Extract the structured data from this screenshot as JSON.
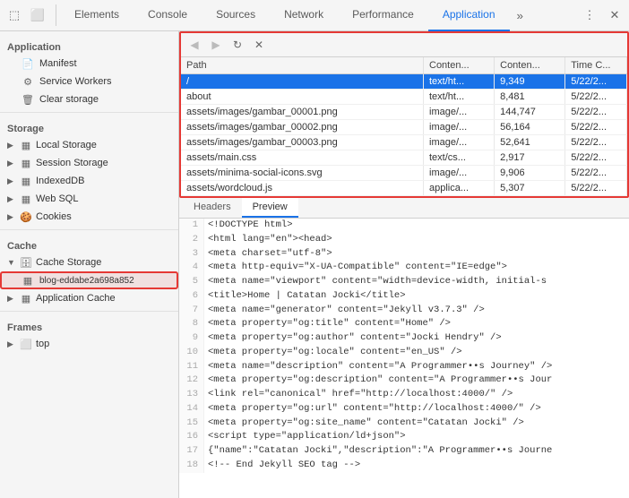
{
  "toolbar": {
    "icons": [
      {
        "name": "inspect-icon",
        "glyph": "⬚"
      },
      {
        "name": "device-icon",
        "glyph": "⬜"
      }
    ],
    "tabs": [
      {
        "id": "elements",
        "label": "Elements"
      },
      {
        "id": "console",
        "label": "Console"
      },
      {
        "id": "sources",
        "label": "Sources"
      },
      {
        "id": "network",
        "label": "Network"
      },
      {
        "id": "performance",
        "label": "Performance"
      },
      {
        "id": "application",
        "label": "Application"
      }
    ],
    "active_tab": "application",
    "overflow_label": "»",
    "more_label": "⋮",
    "close_label": "✕"
  },
  "sidebar": {
    "app_label": "Application",
    "items": [
      {
        "id": "manifest",
        "label": "Manifest",
        "icon": "📄",
        "indent": 1
      },
      {
        "id": "service-workers",
        "label": "Service Workers",
        "icon": "⚙",
        "indent": 1
      },
      {
        "id": "clear-storage",
        "label": "Clear storage",
        "icon": "🗑",
        "indent": 1
      }
    ],
    "storage_label": "Storage",
    "storage_items": [
      {
        "id": "local-storage",
        "label": "Local Storage",
        "icon": "▦",
        "has_arrow": true
      },
      {
        "id": "session-storage",
        "label": "Session Storage",
        "icon": "▦",
        "has_arrow": true
      },
      {
        "id": "indexeddb",
        "label": "IndexedDB",
        "icon": "▦",
        "has_arrow": true
      },
      {
        "id": "web-sql",
        "label": "Web SQL",
        "icon": "▦",
        "has_arrow": true
      },
      {
        "id": "cookies",
        "label": "Cookies",
        "icon": "🍪",
        "has_arrow": true
      }
    ],
    "cache_label": "Cache",
    "cache_items": [
      {
        "id": "cache-storage",
        "label": "Cache Storage",
        "icon": "🗄",
        "has_arrow": true
      },
      {
        "id": "blog-cache",
        "label": "blog-eddabe2a698a852",
        "icon": "▦",
        "highlighted": true
      },
      {
        "id": "app-cache",
        "label": "Application Cache",
        "icon": "▦",
        "has_arrow": true
      }
    ],
    "frames_label": "Frames",
    "frame_items": [
      {
        "id": "frame-top",
        "label": "top",
        "icon": "⬜",
        "has_arrow": true
      }
    ]
  },
  "table": {
    "nav_buttons": [
      {
        "name": "back-btn",
        "label": "◀",
        "disabled": true
      },
      {
        "name": "forward-btn",
        "label": "▶",
        "disabled": true
      },
      {
        "name": "refresh-btn",
        "label": "↻",
        "disabled": false
      },
      {
        "name": "clear-btn",
        "label": "✕",
        "disabled": false
      }
    ],
    "columns": [
      {
        "id": "path",
        "label": "Path"
      },
      {
        "id": "content-type",
        "label": "Conten..."
      },
      {
        "id": "content-enc",
        "label": "Conten..."
      },
      {
        "id": "time-created",
        "label": "Time C..."
      }
    ],
    "rows": [
      {
        "path": "/",
        "content_type": "text/ht...",
        "content_enc": "9,349",
        "time": "5/22/2...",
        "selected": true
      },
      {
        "path": "about",
        "content_type": "text/ht...",
        "content_enc": "8,481",
        "time": "5/22/2...",
        "selected": false
      },
      {
        "path": "assets/images/gambar_00001.png",
        "content_type": "image/...",
        "content_enc": "144,747",
        "time": "5/22/2...",
        "selected": false
      },
      {
        "path": "assets/images/gambar_00002.png",
        "content_type": "image/...",
        "content_enc": "56,164",
        "time": "5/22/2...",
        "selected": false
      },
      {
        "path": "assets/images/gambar_00003.png",
        "content_type": "image/...",
        "content_enc": "52,641",
        "time": "5/22/2...",
        "selected": false
      },
      {
        "path": "assets/main.css",
        "content_type": "text/cs...",
        "content_enc": "2,917",
        "time": "5/22/2...",
        "selected": false
      },
      {
        "path": "assets/minima-social-icons.svg",
        "content_type": "image/...",
        "content_enc": "9,906",
        "time": "5/22/2...",
        "selected": false
      },
      {
        "path": "assets/wordcloud.js",
        "content_type": "applica...",
        "content_enc": "5,307",
        "time": "5/22/2...",
        "selected": false
      }
    ]
  },
  "preview": {
    "tabs": [
      {
        "id": "headers",
        "label": "Headers"
      },
      {
        "id": "preview",
        "label": "Preview"
      }
    ],
    "active_tab": "preview",
    "code_lines": [
      {
        "num": 1,
        "content": "<!DOCTYPE html>"
      },
      {
        "num": 2,
        "content": "<html lang=\"en\"><head>"
      },
      {
        "num": 3,
        "content": "  <meta charset=\"utf-8\">"
      },
      {
        "num": 4,
        "content": "  <meta http-equiv=\"X-UA-Compatible\" content=\"IE=edge\">"
      },
      {
        "num": 5,
        "content": "  <meta name=\"viewport\" content=\"width=device-width, initial-s"
      },
      {
        "num": 6,
        "content": "<title>Home | Catatan Jocki</title>"
      },
      {
        "num": 7,
        "content": "  <meta name=\"generator\" content=\"Jekyll v3.7.3\" />"
      },
      {
        "num": 8,
        "content": "  <meta property=\"og:title\" content=\"Home\" />"
      },
      {
        "num": 9,
        "content": "  <meta property=\"og:author\" content=\"Jocki Hendry\" />"
      },
      {
        "num": 10,
        "content": "  <meta property=\"og:locale\" content=\"en_US\" />"
      },
      {
        "num": 11,
        "content": "  <meta name=\"description\" content=\"A Programmer••s Journey\" />"
      },
      {
        "num": 12,
        "content": "  <meta property=\"og:description\" content=\"A Programmer••s Jour"
      },
      {
        "num": 13,
        "content": "  <link rel=\"canonical\" href=\"http://localhost:4000/\" />"
      },
      {
        "num": 14,
        "content": "  <meta property=\"og:url\" content=\"http://localhost:4000/\" />"
      },
      {
        "num": 15,
        "content": "  <meta property=\"og:site_name\" content=\"Catatan Jocki\" />"
      },
      {
        "num": 16,
        "content": "  <script type=\"application/ld+json\">"
      },
      {
        "num": 17,
        "content": "{\"name\":\"Catatan Jocki\",\"description\":\"A Programmer••s Journe"
      },
      {
        "num": 18,
        "content": "<!-- End Jekyll SEO tag -->"
      }
    ]
  }
}
